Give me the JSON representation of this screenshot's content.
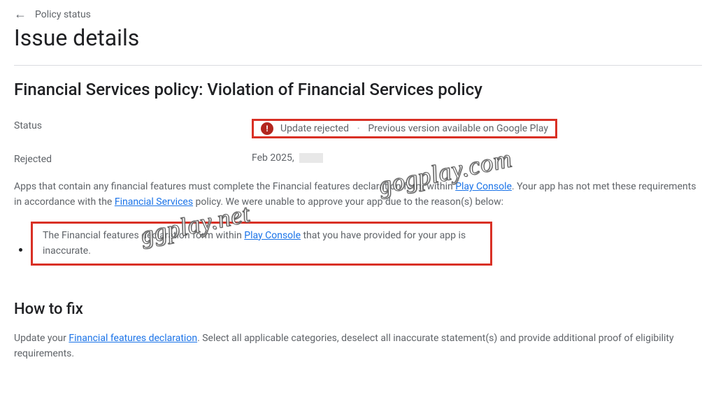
{
  "breadcrumb": {
    "back_arrow": "←",
    "label": "Policy status"
  },
  "page_title": "Issue details",
  "policy_title": "Financial Services policy: Violation of Financial Services policy",
  "status": {
    "label": "Status",
    "value_primary": "Update rejected",
    "value_secondary": "Previous version available on Google Play"
  },
  "rejected": {
    "label": "Rejected",
    "value": "Feb    2025,"
  },
  "description": {
    "prefix": "Apps that contain any financial features must complete the Financial features declaration form within ",
    "link1": "Play Console",
    "mid": ". Your app has not met these requirements in accordance with the ",
    "link2": "Financial Services",
    "suffix": " policy. We were unable to approve your app due to the reason(s) below:"
  },
  "reason": {
    "prefix": "The Financial features declaration form within ",
    "link": "Play Console",
    "suffix": " that you have provided for your app is inaccurate."
  },
  "fix": {
    "title": "How to fix",
    "prefix": "Update your ",
    "link": "Financial features declaration",
    "suffix": ". Select all applicable categories, deselect all inaccurate statement(s) and provide additional proof of eligibility requirements."
  },
  "watermarks": {
    "wm1": "gogplay.com",
    "wm2": "ggplay.net"
  }
}
